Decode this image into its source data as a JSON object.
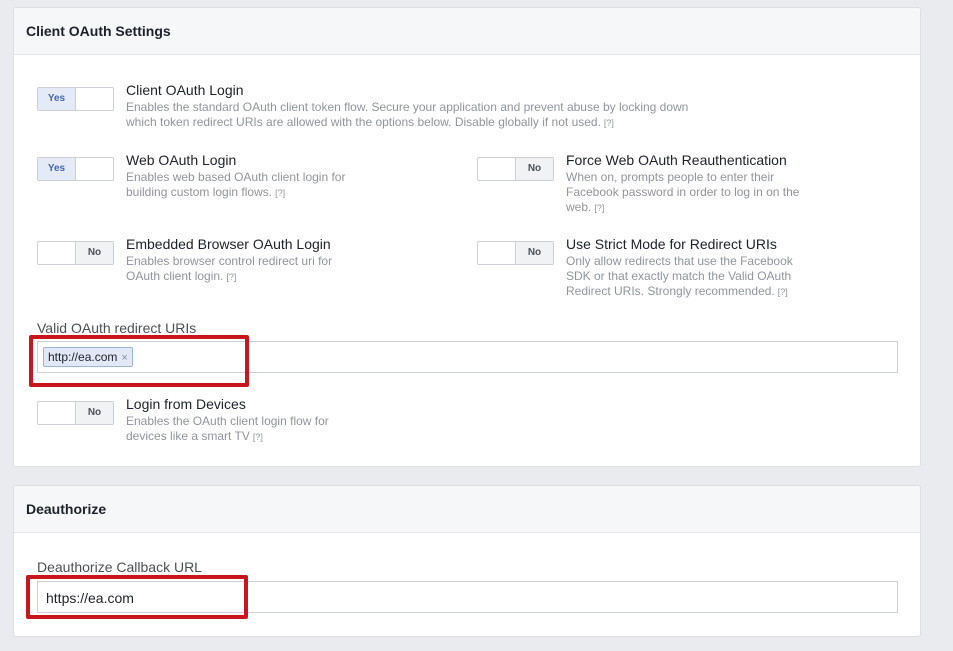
{
  "client_oauth": {
    "title": "Client OAuth Settings",
    "options": {
      "client_oauth_login": {
        "title": "Client OAuth Login",
        "toggle": "Yes",
        "desc_line1": "Enables the standard OAuth client token flow. Secure your application and prevent abuse by locking down",
        "desc_line2": "which token redirect URIs are allowed with the options below. Disable globally if not used.",
        "help": "[?]"
      },
      "web_oauth_login": {
        "title": "Web OAuth Login",
        "toggle": "Yes",
        "desc_line1": "Enables web based OAuth client login for",
        "desc_line2": "building custom login flows.",
        "help": "[?]"
      },
      "force_web_reauth": {
        "title": "Force Web OAuth Reauthentication",
        "toggle": "No",
        "desc_line1": "When on, prompts people to enter their",
        "desc_line2": "Facebook password in order to log in on the",
        "desc_line3": "web.",
        "help": "[?]"
      },
      "embedded_browser": {
        "title": "Embedded Browser OAuth Login",
        "toggle": "No",
        "desc_line1": "Enables browser control redirect uri for",
        "desc_line2": "OAuth client login.",
        "help": "[?]"
      },
      "strict_mode": {
        "title": "Use Strict Mode for Redirect URIs",
        "toggle": "No",
        "desc_line1": "Only allow redirects that use the Facebook",
        "desc_line2": "SDK or that exactly match the Valid OAuth",
        "desc_line3": "Redirect URIs. Strongly recommended.",
        "help": "[?]"
      },
      "login_from_devices": {
        "title": "Login from Devices",
        "toggle": "No",
        "desc_line1": "Enables the OAuth client login flow for",
        "desc_line2": "devices like a smart TV",
        "help": "[?]"
      }
    },
    "redirect_uris": {
      "label": "Valid OAuth redirect URIs",
      "tokens": [
        "http://ea.com"
      ],
      "remove_glyph": "×"
    }
  },
  "deauthorize": {
    "title": "Deauthorize",
    "callback": {
      "label": "Deauthorize Callback URL",
      "value": "https://ea.com"
    }
  },
  "colors": {
    "highlight": "#c8161d",
    "toggle_yes": "#4267b2",
    "page_bg": "#e9ebee"
  }
}
